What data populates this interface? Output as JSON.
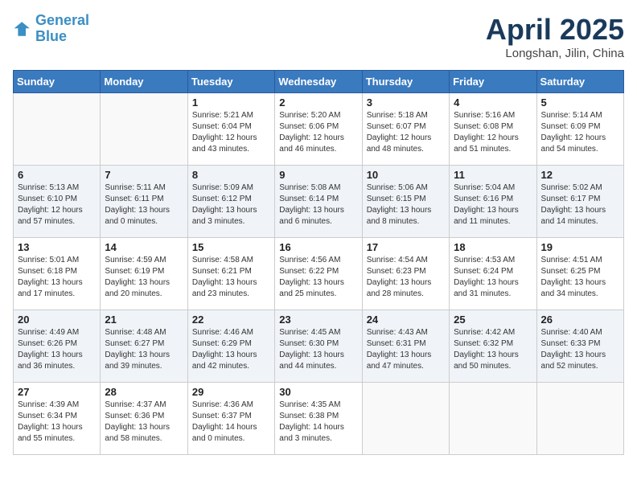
{
  "header": {
    "logo_line1": "General",
    "logo_line2": "Blue",
    "title": "April 2025",
    "subtitle": "Longshan, Jilin, China"
  },
  "days_of_week": [
    "Sunday",
    "Monday",
    "Tuesday",
    "Wednesday",
    "Thursday",
    "Friday",
    "Saturday"
  ],
  "weeks": [
    [
      {
        "day": "",
        "info": ""
      },
      {
        "day": "",
        "info": ""
      },
      {
        "day": "1",
        "info": "Sunrise: 5:21 AM\nSunset: 6:04 PM\nDaylight: 12 hours and 43 minutes."
      },
      {
        "day": "2",
        "info": "Sunrise: 5:20 AM\nSunset: 6:06 PM\nDaylight: 12 hours and 46 minutes."
      },
      {
        "day": "3",
        "info": "Sunrise: 5:18 AM\nSunset: 6:07 PM\nDaylight: 12 hours and 48 minutes."
      },
      {
        "day": "4",
        "info": "Sunrise: 5:16 AM\nSunset: 6:08 PM\nDaylight: 12 hours and 51 minutes."
      },
      {
        "day": "5",
        "info": "Sunrise: 5:14 AM\nSunset: 6:09 PM\nDaylight: 12 hours and 54 minutes."
      }
    ],
    [
      {
        "day": "6",
        "info": "Sunrise: 5:13 AM\nSunset: 6:10 PM\nDaylight: 12 hours and 57 minutes."
      },
      {
        "day": "7",
        "info": "Sunrise: 5:11 AM\nSunset: 6:11 PM\nDaylight: 13 hours and 0 minutes."
      },
      {
        "day": "8",
        "info": "Sunrise: 5:09 AM\nSunset: 6:12 PM\nDaylight: 13 hours and 3 minutes."
      },
      {
        "day": "9",
        "info": "Sunrise: 5:08 AM\nSunset: 6:14 PM\nDaylight: 13 hours and 6 minutes."
      },
      {
        "day": "10",
        "info": "Sunrise: 5:06 AM\nSunset: 6:15 PM\nDaylight: 13 hours and 8 minutes."
      },
      {
        "day": "11",
        "info": "Sunrise: 5:04 AM\nSunset: 6:16 PM\nDaylight: 13 hours and 11 minutes."
      },
      {
        "day": "12",
        "info": "Sunrise: 5:02 AM\nSunset: 6:17 PM\nDaylight: 13 hours and 14 minutes."
      }
    ],
    [
      {
        "day": "13",
        "info": "Sunrise: 5:01 AM\nSunset: 6:18 PM\nDaylight: 13 hours and 17 minutes."
      },
      {
        "day": "14",
        "info": "Sunrise: 4:59 AM\nSunset: 6:19 PM\nDaylight: 13 hours and 20 minutes."
      },
      {
        "day": "15",
        "info": "Sunrise: 4:58 AM\nSunset: 6:21 PM\nDaylight: 13 hours and 23 minutes."
      },
      {
        "day": "16",
        "info": "Sunrise: 4:56 AM\nSunset: 6:22 PM\nDaylight: 13 hours and 25 minutes."
      },
      {
        "day": "17",
        "info": "Sunrise: 4:54 AM\nSunset: 6:23 PM\nDaylight: 13 hours and 28 minutes."
      },
      {
        "day": "18",
        "info": "Sunrise: 4:53 AM\nSunset: 6:24 PM\nDaylight: 13 hours and 31 minutes."
      },
      {
        "day": "19",
        "info": "Sunrise: 4:51 AM\nSunset: 6:25 PM\nDaylight: 13 hours and 34 minutes."
      }
    ],
    [
      {
        "day": "20",
        "info": "Sunrise: 4:49 AM\nSunset: 6:26 PM\nDaylight: 13 hours and 36 minutes."
      },
      {
        "day": "21",
        "info": "Sunrise: 4:48 AM\nSunset: 6:27 PM\nDaylight: 13 hours and 39 minutes."
      },
      {
        "day": "22",
        "info": "Sunrise: 4:46 AM\nSunset: 6:29 PM\nDaylight: 13 hours and 42 minutes."
      },
      {
        "day": "23",
        "info": "Sunrise: 4:45 AM\nSunset: 6:30 PM\nDaylight: 13 hours and 44 minutes."
      },
      {
        "day": "24",
        "info": "Sunrise: 4:43 AM\nSunset: 6:31 PM\nDaylight: 13 hours and 47 minutes."
      },
      {
        "day": "25",
        "info": "Sunrise: 4:42 AM\nSunset: 6:32 PM\nDaylight: 13 hours and 50 minutes."
      },
      {
        "day": "26",
        "info": "Sunrise: 4:40 AM\nSunset: 6:33 PM\nDaylight: 13 hours and 52 minutes."
      }
    ],
    [
      {
        "day": "27",
        "info": "Sunrise: 4:39 AM\nSunset: 6:34 PM\nDaylight: 13 hours and 55 minutes."
      },
      {
        "day": "28",
        "info": "Sunrise: 4:37 AM\nSunset: 6:36 PM\nDaylight: 13 hours and 58 minutes."
      },
      {
        "day": "29",
        "info": "Sunrise: 4:36 AM\nSunset: 6:37 PM\nDaylight: 14 hours and 0 minutes."
      },
      {
        "day": "30",
        "info": "Sunrise: 4:35 AM\nSunset: 6:38 PM\nDaylight: 14 hours and 3 minutes."
      },
      {
        "day": "",
        "info": ""
      },
      {
        "day": "",
        "info": ""
      },
      {
        "day": "",
        "info": ""
      }
    ]
  ]
}
